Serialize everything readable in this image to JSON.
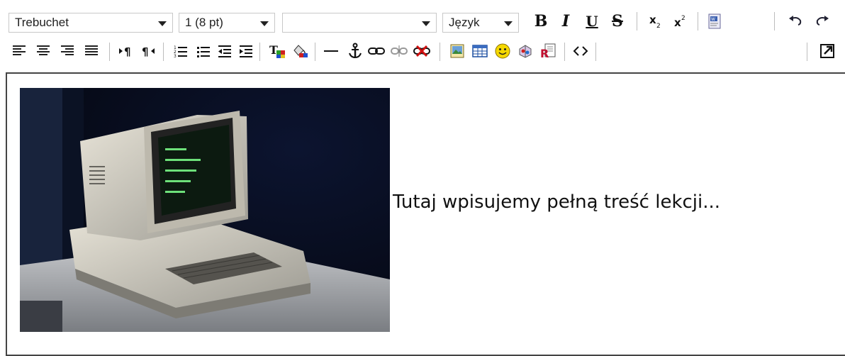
{
  "toolbar": {
    "font_family": "Trebuchet",
    "font_size": "1 (8 pt)",
    "format_value": "",
    "language_label": "Język",
    "bold_label": "B",
    "italic_label": "I",
    "underline_label": "U",
    "strike_label": "S",
    "icons_row1": [
      "bold-icon",
      "italic-icon",
      "underline-icon",
      "strikethrough-icon",
      "subscript-icon",
      "superscript-icon",
      "paste-word-icon",
      "undo-icon",
      "redo-icon"
    ],
    "icons_row2": [
      "align-left-icon",
      "align-center-icon",
      "align-right-icon",
      "justify-icon",
      "ltr-icon",
      "rtl-icon",
      "ordered-list-icon",
      "unordered-list-icon",
      "outdent-icon",
      "indent-icon",
      "text-color-icon",
      "background-color-icon",
      "horizontal-rule-icon",
      "anchor-icon",
      "link-icon",
      "unlink-icon",
      "nolink-icon",
      "image-icon",
      "table-icon",
      "emoticon-icon",
      "moodle-media-icon",
      "search-replace-icon",
      "html-source-icon",
      "fullscreen-icon"
    ]
  },
  "editor": {
    "content_text": "Tutaj wpisujemy pełną treść lekcji..."
  }
}
